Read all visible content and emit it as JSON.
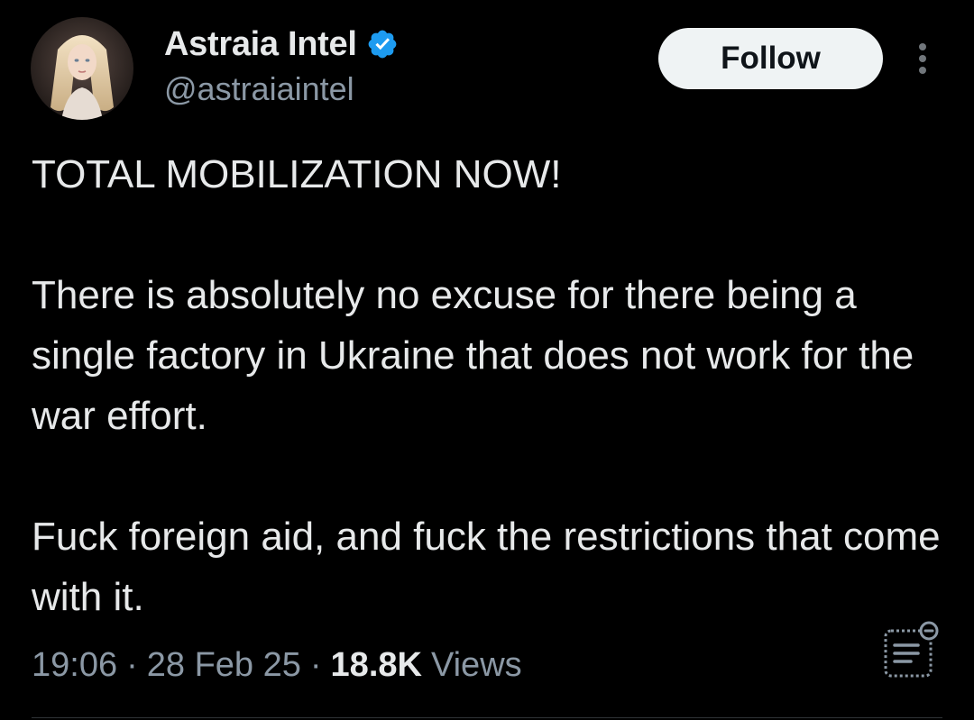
{
  "post": {
    "author": {
      "display_name": "Astraia Intel",
      "handle": "@astraiaintel",
      "verified": true,
      "avatar_icon": "avatar-image"
    },
    "follow_label": "Follow",
    "more_icon": "more-vertical-icon",
    "text": {
      "line1": "TOTAL MOBILIZATION NOW!",
      "line2": "There is absolutely no excuse for there being a single factory in Ukraine that does not work for the war effort.",
      "line3": "Fuck foreign aid, and fuck the restrictions that come with it."
    },
    "meta": {
      "time": "19:06",
      "separator": "·",
      "date": "28 Feb 25",
      "views_count": "18.8K",
      "views_label": "Views"
    },
    "notes_icon": "community-notes-icon"
  },
  "colors": {
    "background": "#000000",
    "text_primary": "#e7e9ea",
    "text_secondary": "#8b98a5",
    "verified_blue": "#1d9bf0",
    "follow_button_bg": "#eff3f4",
    "follow_button_text": "#0f1419"
  }
}
